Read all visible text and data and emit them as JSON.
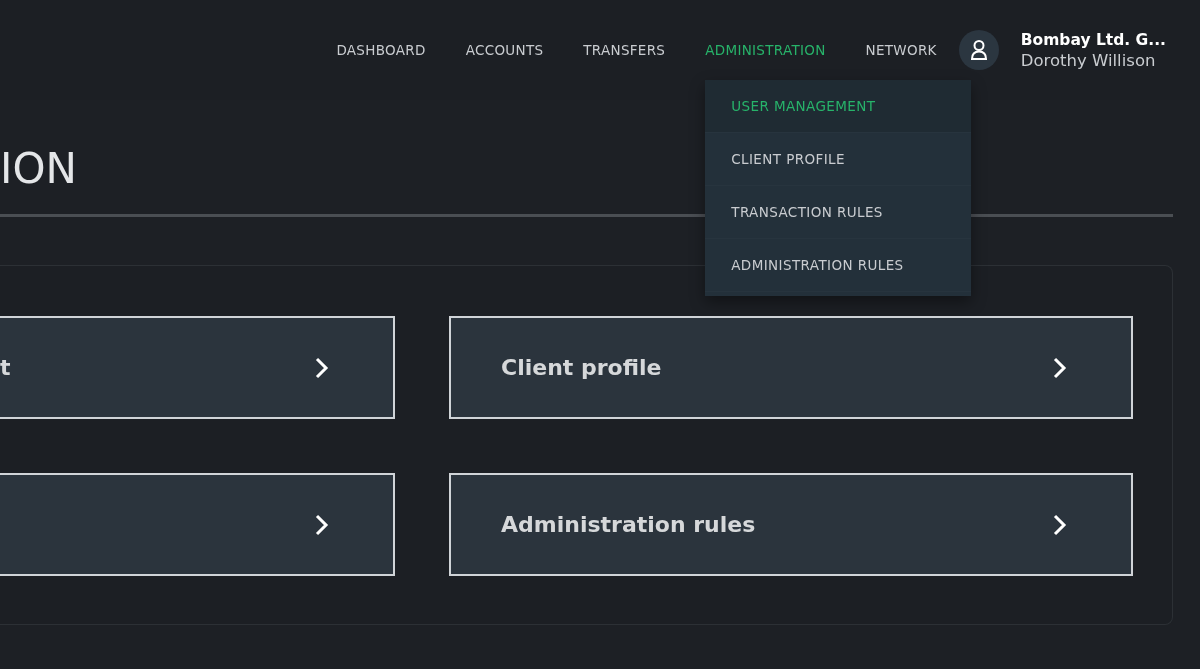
{
  "nav": [
    {
      "label": "DASHBOARD",
      "selected": false
    },
    {
      "label": "ACCOUNTS",
      "selected": false
    },
    {
      "label": "TRANSFERS",
      "selected": false
    },
    {
      "label": "ADMINISTRATION",
      "selected": true,
      "expanded": true
    },
    {
      "label": "NETWORK",
      "selected": false
    }
  ],
  "dropdown": [
    {
      "label": "USER MANAGEMENT",
      "selected": true
    },
    {
      "label": "CLIENT PROFILE",
      "selected": false
    },
    {
      "label": "TRANSACTION RULES",
      "selected": false
    },
    {
      "label": "ADMINISTRATION RULES",
      "selected": false
    }
  ],
  "user": {
    "company": "Bombay Ltd. G...",
    "name": "Dorothy Willison"
  },
  "page_title": "ION",
  "cards": [
    {
      "label": "t",
      "chevron": true
    },
    {
      "label": "Client profile",
      "chevron": true
    },
    {
      "chevron": true
    },
    {
      "label": "Administration rules",
      "chevron": true
    }
  ]
}
